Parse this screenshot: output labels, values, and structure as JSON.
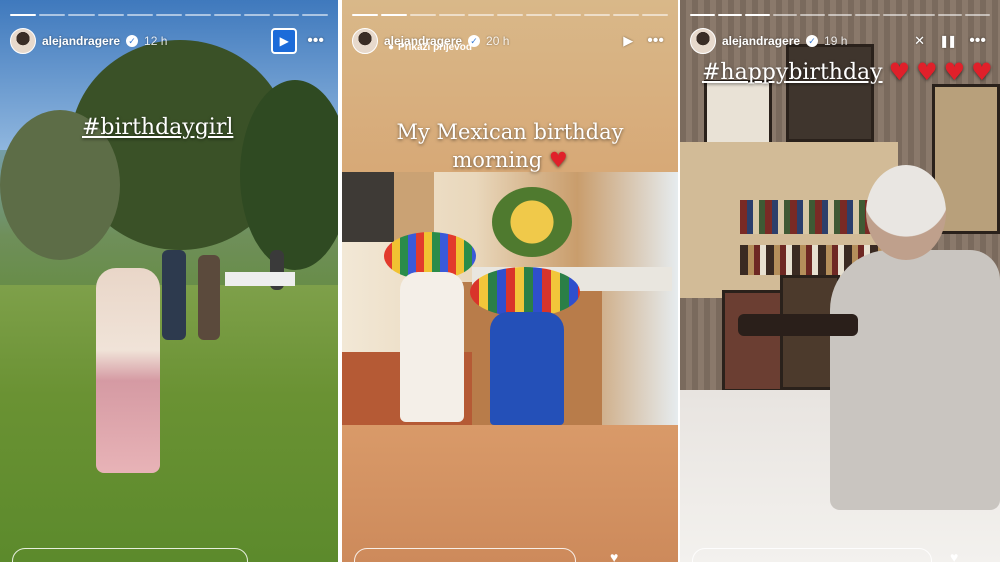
{
  "stories": [
    {
      "username": "alejandragere",
      "time": "12 h",
      "caption": "#birthdaygirl",
      "progress_done": 1,
      "progress_total": 11
    },
    {
      "username": "alejandragere",
      "time": "20 h",
      "translate_label": "Prikaži prijevod",
      "caption_line1": "My Mexican birthday",
      "caption_line2": "morning",
      "progress_done": 2,
      "progress_total": 11
    },
    {
      "username": "alejandragere",
      "time": "19 h",
      "caption": "#happybirthday",
      "progress_done": 3,
      "progress_total": 11
    }
  ],
  "icons": {
    "play": "▶",
    "more": "•••",
    "pause": "❚❚",
    "mute": "🔇",
    "heart": "♥",
    "verified": "✓"
  },
  "colors": {
    "heart_red": "#e0202a",
    "active_play_bg": "#1c6bd9"
  }
}
